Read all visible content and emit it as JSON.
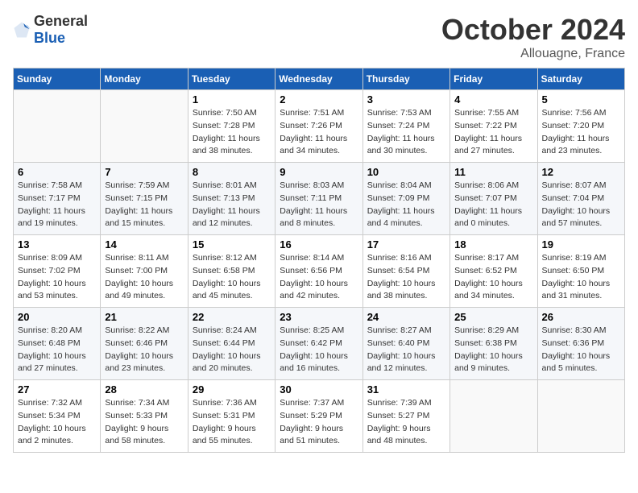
{
  "header": {
    "logo_general": "General",
    "logo_blue": "Blue",
    "month_title": "October 2024",
    "location": "Allouagne, France"
  },
  "weekdays": [
    "Sunday",
    "Monday",
    "Tuesday",
    "Wednesday",
    "Thursday",
    "Friday",
    "Saturday"
  ],
  "weeks": [
    [
      {
        "day": "",
        "sunrise": "",
        "sunset": "",
        "daylight": ""
      },
      {
        "day": "",
        "sunrise": "",
        "sunset": "",
        "daylight": ""
      },
      {
        "day": "1",
        "sunrise": "Sunrise: 7:50 AM",
        "sunset": "Sunset: 7:28 PM",
        "daylight": "Daylight: 11 hours and 38 minutes."
      },
      {
        "day": "2",
        "sunrise": "Sunrise: 7:51 AM",
        "sunset": "Sunset: 7:26 PM",
        "daylight": "Daylight: 11 hours and 34 minutes."
      },
      {
        "day": "3",
        "sunrise": "Sunrise: 7:53 AM",
        "sunset": "Sunset: 7:24 PM",
        "daylight": "Daylight: 11 hours and 30 minutes."
      },
      {
        "day": "4",
        "sunrise": "Sunrise: 7:55 AM",
        "sunset": "Sunset: 7:22 PM",
        "daylight": "Daylight: 11 hours and 27 minutes."
      },
      {
        "day": "5",
        "sunrise": "Sunrise: 7:56 AM",
        "sunset": "Sunset: 7:20 PM",
        "daylight": "Daylight: 11 hours and 23 minutes."
      }
    ],
    [
      {
        "day": "6",
        "sunrise": "Sunrise: 7:58 AM",
        "sunset": "Sunset: 7:17 PM",
        "daylight": "Daylight: 11 hours and 19 minutes."
      },
      {
        "day": "7",
        "sunrise": "Sunrise: 7:59 AM",
        "sunset": "Sunset: 7:15 PM",
        "daylight": "Daylight: 11 hours and 15 minutes."
      },
      {
        "day": "8",
        "sunrise": "Sunrise: 8:01 AM",
        "sunset": "Sunset: 7:13 PM",
        "daylight": "Daylight: 11 hours and 12 minutes."
      },
      {
        "day": "9",
        "sunrise": "Sunrise: 8:03 AM",
        "sunset": "Sunset: 7:11 PM",
        "daylight": "Daylight: 11 hours and 8 minutes."
      },
      {
        "day": "10",
        "sunrise": "Sunrise: 8:04 AM",
        "sunset": "Sunset: 7:09 PM",
        "daylight": "Daylight: 11 hours and 4 minutes."
      },
      {
        "day": "11",
        "sunrise": "Sunrise: 8:06 AM",
        "sunset": "Sunset: 7:07 PM",
        "daylight": "Daylight: 11 hours and 0 minutes."
      },
      {
        "day": "12",
        "sunrise": "Sunrise: 8:07 AM",
        "sunset": "Sunset: 7:04 PM",
        "daylight": "Daylight: 10 hours and 57 minutes."
      }
    ],
    [
      {
        "day": "13",
        "sunrise": "Sunrise: 8:09 AM",
        "sunset": "Sunset: 7:02 PM",
        "daylight": "Daylight: 10 hours and 53 minutes."
      },
      {
        "day": "14",
        "sunrise": "Sunrise: 8:11 AM",
        "sunset": "Sunset: 7:00 PM",
        "daylight": "Daylight: 10 hours and 49 minutes."
      },
      {
        "day": "15",
        "sunrise": "Sunrise: 8:12 AM",
        "sunset": "Sunset: 6:58 PM",
        "daylight": "Daylight: 10 hours and 45 minutes."
      },
      {
        "day": "16",
        "sunrise": "Sunrise: 8:14 AM",
        "sunset": "Sunset: 6:56 PM",
        "daylight": "Daylight: 10 hours and 42 minutes."
      },
      {
        "day": "17",
        "sunrise": "Sunrise: 8:16 AM",
        "sunset": "Sunset: 6:54 PM",
        "daylight": "Daylight: 10 hours and 38 minutes."
      },
      {
        "day": "18",
        "sunrise": "Sunrise: 8:17 AM",
        "sunset": "Sunset: 6:52 PM",
        "daylight": "Daylight: 10 hours and 34 minutes."
      },
      {
        "day": "19",
        "sunrise": "Sunrise: 8:19 AM",
        "sunset": "Sunset: 6:50 PM",
        "daylight": "Daylight: 10 hours and 31 minutes."
      }
    ],
    [
      {
        "day": "20",
        "sunrise": "Sunrise: 8:20 AM",
        "sunset": "Sunset: 6:48 PM",
        "daylight": "Daylight: 10 hours and 27 minutes."
      },
      {
        "day": "21",
        "sunrise": "Sunrise: 8:22 AM",
        "sunset": "Sunset: 6:46 PM",
        "daylight": "Daylight: 10 hours and 23 minutes."
      },
      {
        "day": "22",
        "sunrise": "Sunrise: 8:24 AM",
        "sunset": "Sunset: 6:44 PM",
        "daylight": "Daylight: 10 hours and 20 minutes."
      },
      {
        "day": "23",
        "sunrise": "Sunrise: 8:25 AM",
        "sunset": "Sunset: 6:42 PM",
        "daylight": "Daylight: 10 hours and 16 minutes."
      },
      {
        "day": "24",
        "sunrise": "Sunrise: 8:27 AM",
        "sunset": "Sunset: 6:40 PM",
        "daylight": "Daylight: 10 hours and 12 minutes."
      },
      {
        "day": "25",
        "sunrise": "Sunrise: 8:29 AM",
        "sunset": "Sunset: 6:38 PM",
        "daylight": "Daylight: 10 hours and 9 minutes."
      },
      {
        "day": "26",
        "sunrise": "Sunrise: 8:30 AM",
        "sunset": "Sunset: 6:36 PM",
        "daylight": "Daylight: 10 hours and 5 minutes."
      }
    ],
    [
      {
        "day": "27",
        "sunrise": "Sunrise: 7:32 AM",
        "sunset": "Sunset: 5:34 PM",
        "daylight": "Daylight: 10 hours and 2 minutes."
      },
      {
        "day": "28",
        "sunrise": "Sunrise: 7:34 AM",
        "sunset": "Sunset: 5:33 PM",
        "daylight": "Daylight: 9 hours and 58 minutes."
      },
      {
        "day": "29",
        "sunrise": "Sunrise: 7:36 AM",
        "sunset": "Sunset: 5:31 PM",
        "daylight": "Daylight: 9 hours and 55 minutes."
      },
      {
        "day": "30",
        "sunrise": "Sunrise: 7:37 AM",
        "sunset": "Sunset: 5:29 PM",
        "daylight": "Daylight: 9 hours and 51 minutes."
      },
      {
        "day": "31",
        "sunrise": "Sunrise: 7:39 AM",
        "sunset": "Sunset: 5:27 PM",
        "daylight": "Daylight: 9 hours and 48 minutes."
      },
      {
        "day": "",
        "sunrise": "",
        "sunset": "",
        "daylight": ""
      },
      {
        "day": "",
        "sunrise": "",
        "sunset": "",
        "daylight": ""
      }
    ]
  ]
}
